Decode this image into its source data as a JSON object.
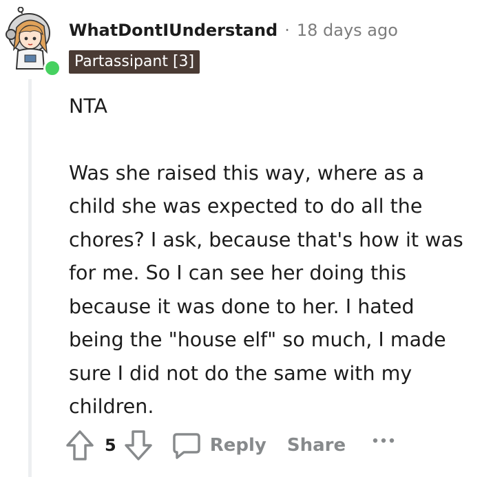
{
  "comment": {
    "author": "WhatDontIUnderstand",
    "separator": "·",
    "timestamp": "18 days ago",
    "flair": "Partassipant [3]",
    "paragraphs": [
      "NTA",
      "Was she raised this way, where as a child she was expected to do all the chores? I ask, because that's how it was for me. So I can see her doing this because it was done to her. I hated being the \"house elf\" so much, I made sure I did not do the same with my children."
    ]
  },
  "actions": {
    "upvote_icon": "arrow-up-icon",
    "vote_count": "5",
    "downvote_icon": "arrow-down-icon",
    "reply_icon": "speech-bubble-icon",
    "reply_label": "Reply",
    "share_label": "Share",
    "more_icon": "more-dots-icon"
  },
  "colors": {
    "text": "#1c1c1c",
    "muted": "#7c7c7c",
    "action_gray": "#878a8c",
    "flair_bg": "#4a3b34",
    "online": "#46d160",
    "thread_line": "#edeff1"
  }
}
